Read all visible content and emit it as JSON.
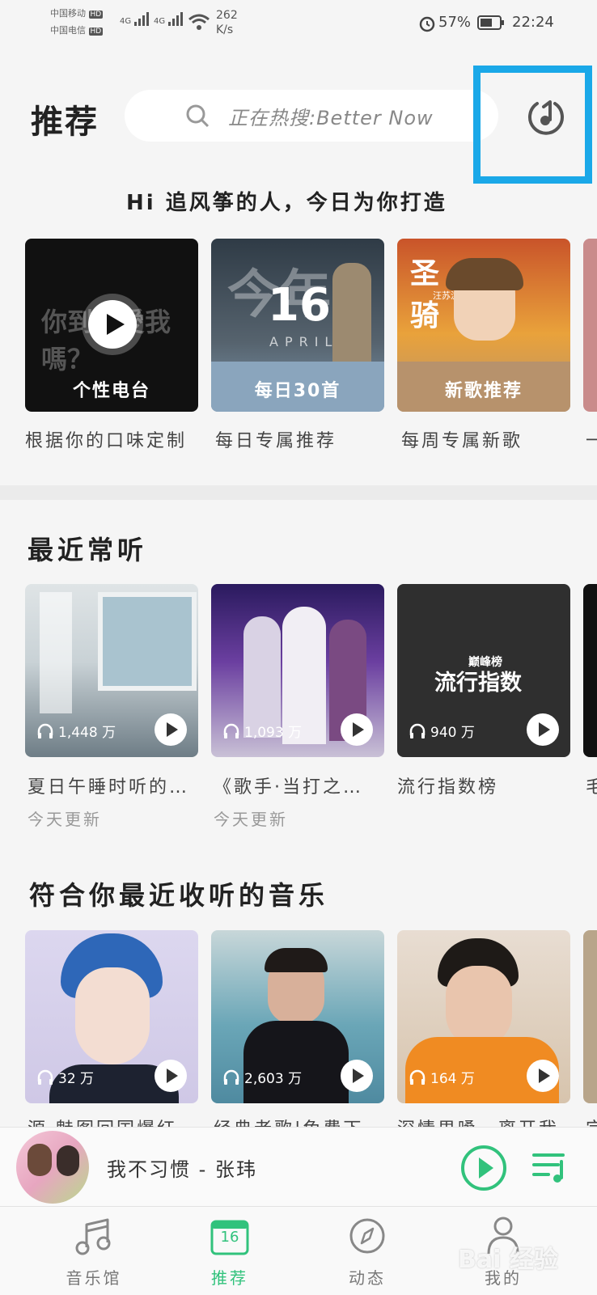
{
  "status_bar": {
    "carrier1": "中国移动",
    "carrier2": "中国电信",
    "hd": "HD",
    "net": "4G",
    "speed_value": "262",
    "speed_unit": "K/s",
    "battery": "57%",
    "time": "22:24"
  },
  "header": {
    "title": "推荐",
    "search_placeholder": "正在热搜:Better Now"
  },
  "greeting": "Hi 追风筝的人，今日为你打造",
  "top_cards": [
    {
      "overlay_text": "你到底愛我嗎？",
      "label": "个性电台",
      "subtitle": "根据你的口味定制"
    },
    {
      "badge_number": "16",
      "badge_month": "APRIL",
      "overlay_text": "今年",
      "label": "每日30首",
      "subtitle": "每日专属推荐"
    },
    {
      "banner_text": "圣殿骑士",
      "banner_sub": "汪苏泷",
      "label": "新歌推荐",
      "subtitle": "每周专属新歌"
    },
    {
      "subtitle": "一"
    }
  ],
  "recent": {
    "title": "最近常听",
    "items": [
      {
        "count": "1,448 万",
        "name": "夏日午睡时听的…",
        "meta": "今天更新"
      },
      {
        "count": "1,093 万",
        "name": "《歌手·当打之…",
        "meta": "今天更新"
      },
      {
        "count": "940 万",
        "cover_text": "流行指数",
        "logo_text": "巅峰榜",
        "name": "流行指数榜"
      },
      {
        "name": "毛"
      }
    ]
  },
  "suggested": {
    "title": "符合你最近收听的音乐",
    "items": [
      {
        "count": "32 万",
        "name": "源·魅图回国爆红"
      },
      {
        "count": "2,603 万",
        "name": "经典老歌|免费下"
      },
      {
        "count": "164 万",
        "name": "深情男嗓，离开我"
      },
      {
        "name": "完"
      }
    ]
  },
  "player": {
    "now_playing": "我不习惯 - 张玮"
  },
  "nav": {
    "active": "tab-recommend",
    "items": [
      {
        "label": "音乐馆"
      },
      {
        "label": "推荐",
        "day": "16"
      },
      {
        "label": "动态"
      },
      {
        "label": "我的"
      }
    ]
  },
  "watermark": "Bai 经验",
  "colors": {
    "accent": "#31c27c",
    "highlight_box": "#1aa8e8"
  }
}
